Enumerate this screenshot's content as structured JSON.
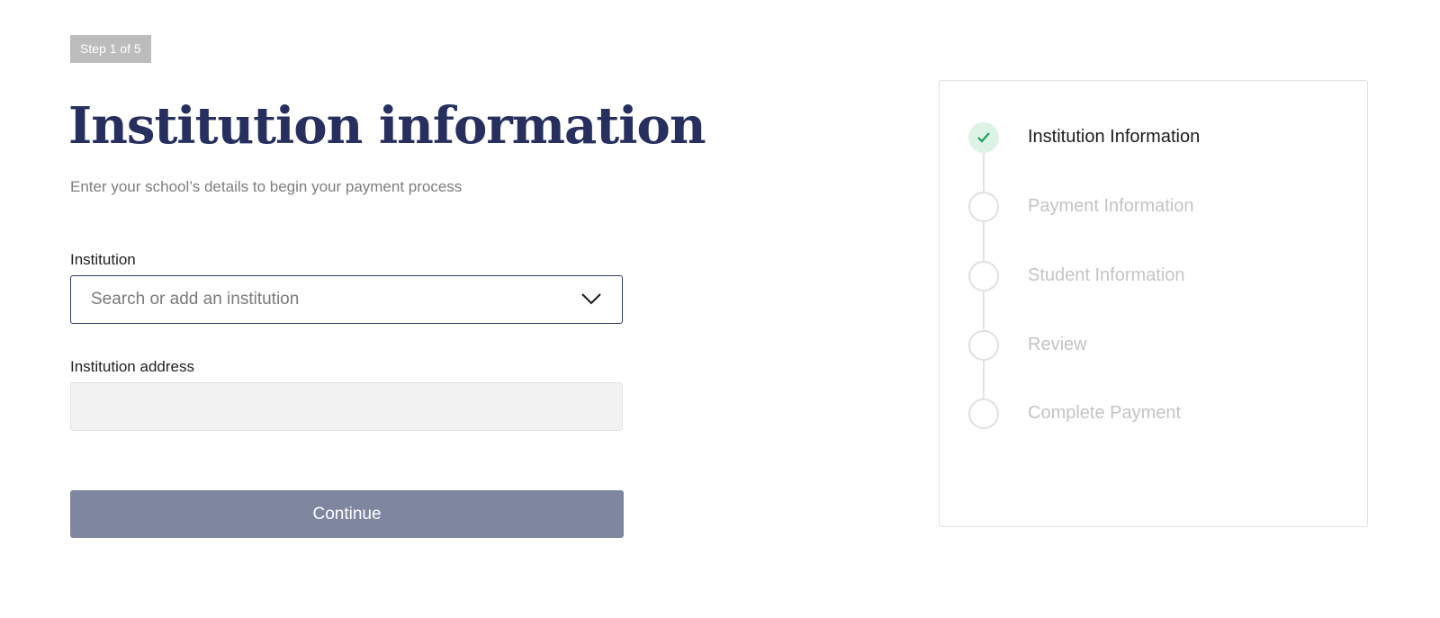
{
  "step_indicator": "Step 1 of 5",
  "title": "Institution information",
  "subtitle": "Enter your school’s details to begin your payment process",
  "form": {
    "institution": {
      "label": "Institution",
      "placeholder": "Search or add an institution",
      "value": "",
      "icon": "chevron-down-icon"
    },
    "address": {
      "label": "Institution address",
      "value": ""
    },
    "continue_label": "Continue"
  },
  "progress": {
    "steps": [
      {
        "label": "Institution Information",
        "status": "complete"
      },
      {
        "label": "Payment Information",
        "status": "upcoming"
      },
      {
        "label": "Student Information",
        "status": "upcoming"
      },
      {
        "label": "Review",
        "status": "upcoming"
      },
      {
        "label": "Complete Payment",
        "status": "upcoming"
      }
    ]
  },
  "colors": {
    "title": "#262f5e",
    "button": "#7f86a0",
    "complete_circle": "#dcf3e6",
    "check": "#1f9d55",
    "inactive": "#c4c4c4"
  }
}
